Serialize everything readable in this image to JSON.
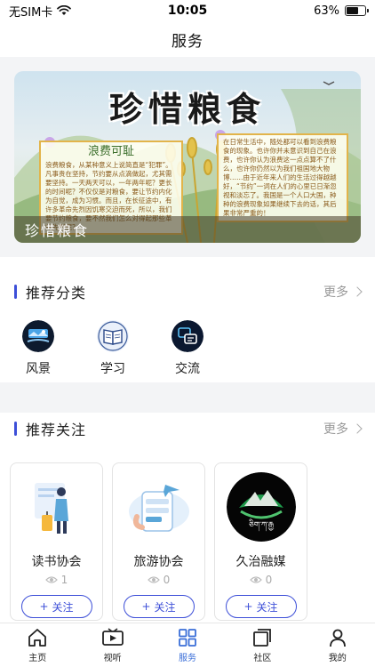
{
  "status_bar": {
    "carrier": "无SIM卡",
    "time": "10:05",
    "battery": "63%",
    "battery_level": 0.63
  },
  "header": {
    "title": "服务"
  },
  "banner": {
    "title": "珍惜粮食",
    "caption": "珍惜粮食",
    "left_note_heading": "浪费可耻",
    "left_note_text": "浪费粮食，从某种意义上说简直是“犯罪”。凡事贵在坚持，节约要从点滴做起，尤其需要坚持。一天两天可以，一年两年呢？更长的时间呢？不仅仅是对粮食，要让节约内化为自觉，成为习惯。而且，在长征途中，有许多革命先烈因饥寒交迫而死，所以，我们要节约粮食，要不然我们怎么对得起那些革命先烈呢？",
    "right_note_text": "在日常生活中，随处都可以看到浪费粮食的现象。也许你并未意识到自己在浪费，也许你认为浪费这一点点算不了什么，也许你仍然以为我们祖国地大物博……由于近年来人们的生活过得越越好，“节约”一词在人们的心里已日渐忽视和淡忘了。我国是一个人口大国，种种的浪费现象如果继续下去的话，其后果非常严重的！"
  },
  "recommend_categories": {
    "title": "推荐分类",
    "more": "更多",
    "items": [
      {
        "label": "风景",
        "icon": "landscape-icon"
      },
      {
        "label": "学习",
        "icon": "book-icon"
      },
      {
        "label": "交流",
        "icon": "chat-icon"
      }
    ]
  },
  "recommend_follow": {
    "title": "推荐关注",
    "more": "更多",
    "follow_label": "关注",
    "cards": [
      {
        "name": "读书协会",
        "views": "1",
        "image": "traveler-illustration"
      },
      {
        "name": "旅游协会",
        "views": "0",
        "image": "travel-booking-illustration"
      },
      {
        "name": "久治融媒",
        "views": "0",
        "image": "jiuzhi-media-logo",
        "logo_text": "ཅིག་ཀ་རྒྱ"
      }
    ]
  },
  "tab_bar": {
    "tabs": [
      {
        "label": "主页",
        "icon": "home-icon",
        "active": false
      },
      {
        "label": "视听",
        "icon": "video-icon",
        "active": false
      },
      {
        "label": "服务",
        "icon": "grid-icon",
        "active": true
      },
      {
        "label": "社区",
        "icon": "community-icon",
        "active": false
      },
      {
        "label": "我的",
        "icon": "user-icon",
        "active": false
      }
    ]
  },
  "colors": {
    "accent": "#3d4fd8",
    "tab_active": "#3b6fd8",
    "band": "#f3f4f6"
  }
}
